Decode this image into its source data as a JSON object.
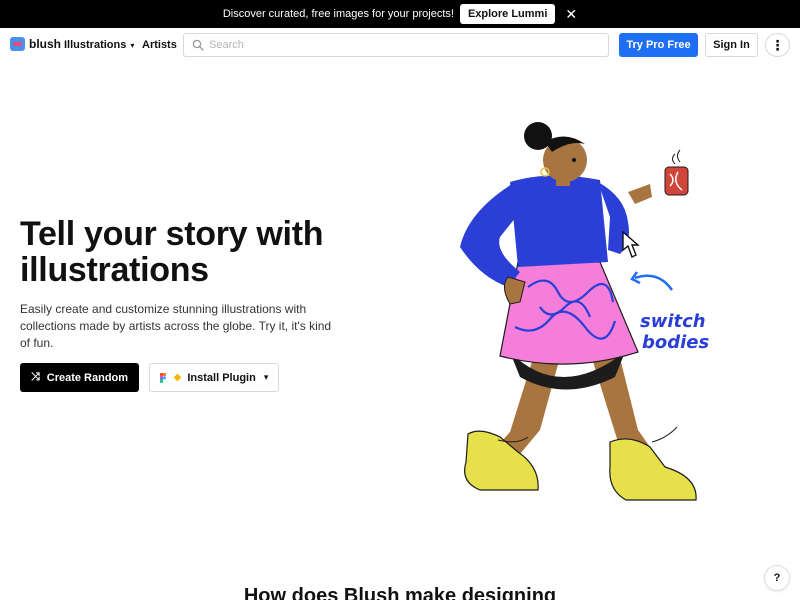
{
  "announcement": {
    "message": "Discover curated, free images for your projects!",
    "cta_label": "Explore Lummi",
    "close_icon": "close-icon"
  },
  "nav": {
    "logo_text": "blush",
    "links": [
      {
        "label": "Illustrations",
        "has_dropdown": true
      },
      {
        "label": "Artists",
        "has_dropdown": false
      }
    ],
    "search": {
      "placeholder": "Search",
      "value": ""
    },
    "try_pro_label": "Try Pro Free",
    "sign_in_label": "Sign In",
    "more_icon": "vertical-dots-icon"
  },
  "hero": {
    "title": "Tell your story with illustrations",
    "subtitle": "Easily create and customize stunning illustrations with collections made by artists across the globe. Try it, it's kind of fun.",
    "primary_button": "Create Random",
    "secondary_button": "Install Plugin",
    "illustration_caption": [
      "switch",
      "bodies"
    ]
  },
  "section": {
    "title": "How does Blush make designing"
  },
  "help_label": "?",
  "colors": {
    "accent": "#1f6ff5",
    "shirt": "#2b3fd6",
    "skirt": "#f47ed9",
    "shoes": "#e6e04a",
    "skin": "#a8743f"
  }
}
